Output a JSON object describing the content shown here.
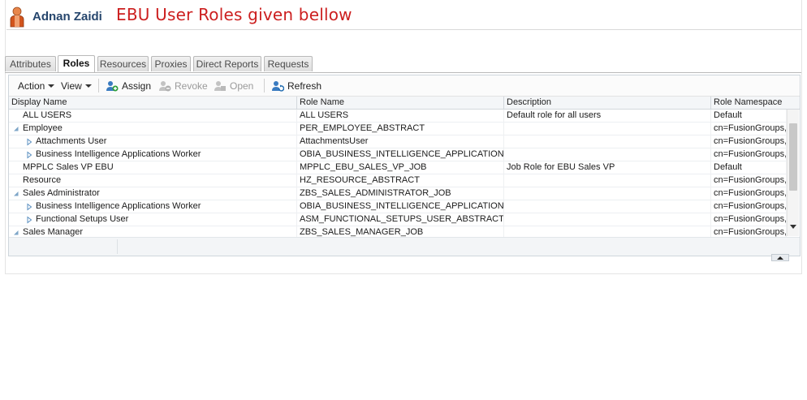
{
  "header": {
    "user_name": "Adnan Zaidi",
    "note": "EBU User Roles given bellow"
  },
  "tabs": [
    {
      "label": "Attributes",
      "active": false
    },
    {
      "label": "Roles",
      "active": true
    },
    {
      "label": "Resources",
      "active": false
    },
    {
      "label": "Proxies",
      "active": false
    },
    {
      "label": "Direct Reports",
      "active": false
    },
    {
      "label": "Requests",
      "active": false
    }
  ],
  "toolbar": {
    "action_label": "Action",
    "view_label": "View",
    "assign_label": "Assign",
    "revoke_label": "Revoke",
    "open_label": "Open",
    "refresh_label": "Refresh"
  },
  "columns": [
    "Display Name",
    "Role Name",
    "Description",
    "Role Namespace"
  ],
  "rows": [
    {
      "display": "ALL USERS",
      "role": "ALL USERS",
      "desc": "Default role for all users",
      "ns": "Default",
      "expand": "none",
      "level": 0
    },
    {
      "display": "Employee",
      "role": "PER_EMPLOYEE_ABSTRACT",
      "desc": "",
      "ns": "cn=FusionGroups,",
      "expand": "open",
      "level": 0
    },
    {
      "display": "Attachments User",
      "role": "AttachmentsUser",
      "desc": "",
      "ns": "cn=FusionGroups,",
      "expand": "closed",
      "level": 1
    },
    {
      "display": "Business Intelligence Applications Worker",
      "role": "OBIA_BUSINESS_INTELLIGENCE_APPLICATIONS_...",
      "desc": "",
      "ns": "cn=FusionGroups,",
      "expand": "closed",
      "level": 1
    },
    {
      "display": "MPPLC Sales VP EBU",
      "role": "MPPLC_EBU_SALES_VP_JOB",
      "desc": "Job Role for EBU Sales VP",
      "ns": "Default",
      "expand": "none",
      "level": 0
    },
    {
      "display": "Resource",
      "role": "HZ_RESOURCE_ABSTRACT",
      "desc": "",
      "ns": "cn=FusionGroups,",
      "expand": "none",
      "level": 0
    },
    {
      "display": "Sales Administrator",
      "role": "ZBS_SALES_ADMINISTRATOR_JOB",
      "desc": "",
      "ns": "cn=FusionGroups,",
      "expand": "open",
      "level": 0
    },
    {
      "display": "Business Intelligence Applications Worker",
      "role": "OBIA_BUSINESS_INTELLIGENCE_APPLICATIONS_...",
      "desc": "",
      "ns": "cn=FusionGroups,",
      "expand": "closed",
      "level": 1
    },
    {
      "display": "Functional Setups User",
      "role": "ASM_FUNCTIONAL_SETUPS_USER_ABSTRACT",
      "desc": "",
      "ns": "cn=FusionGroups,",
      "expand": "closed",
      "level": 1
    },
    {
      "display": "Sales Manager",
      "role": "ZBS_SALES_MANAGER_JOB",
      "desc": "",
      "ns": "cn=FusionGroups,",
      "expand": "open",
      "level": 0
    }
  ]
}
